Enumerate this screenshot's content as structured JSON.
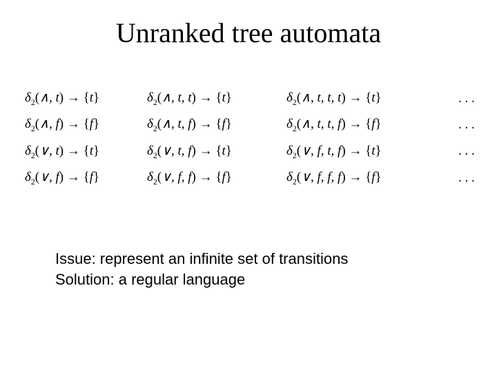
{
  "title": "Unranked tree automata",
  "dots": ". . .",
  "caption": {
    "line1": "Issue: represent an infinite set of transitions",
    "line2": "Solution: a regular language"
  },
  "sym": {
    "delta": "δ",
    "sub2": "2",
    "and": "∧",
    "or": "∨",
    "t": "t",
    "f": "f",
    "arrow": "→",
    "lb": "{",
    "rb": "}",
    "lp": "(",
    "rp": ")",
    "comma": ","
  },
  "rows": [
    {
      "op": "and",
      "args": [
        "t"
      ],
      "res": "t",
      "args2": [
        "t",
        "t"
      ],
      "res2": "t",
      "args3": [
        "t",
        "t",
        "t"
      ],
      "res3": "t"
    },
    {
      "op": "and",
      "args": [
        "f"
      ],
      "res": "f",
      "args2": [
        "t",
        "f"
      ],
      "res2": "f",
      "args3": [
        "t",
        "t",
        "f"
      ],
      "res3": "f"
    },
    {
      "op": "or",
      "args": [
        "t"
      ],
      "res": "t",
      "args2": [
        "t",
        "f"
      ],
      "res2": "t",
      "args3": [
        "f",
        "t",
        "f"
      ],
      "res3": "t"
    },
    {
      "op": "or",
      "args": [
        "f"
      ],
      "res": "f",
      "args2": [
        "f",
        "f"
      ],
      "res2": "f",
      "args3": [
        "f",
        "f",
        "f"
      ],
      "res3": "f"
    }
  ]
}
